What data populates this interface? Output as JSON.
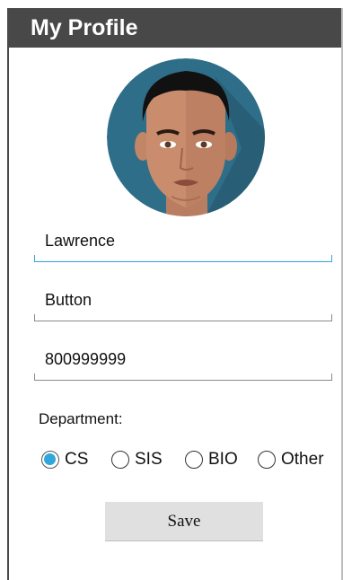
{
  "header": {
    "title": "My Profile"
  },
  "profile": {
    "first_name": "Lawrence",
    "last_name": "Button",
    "phone": "800999999"
  },
  "department": {
    "label": "Department:",
    "options": [
      "CS",
      "SIS",
      "BIO",
      "Other"
    ],
    "selected": "CS"
  },
  "actions": {
    "save_label": "Save"
  },
  "colors": {
    "accent": "#2fa7dc",
    "titlebar": "#484848"
  }
}
